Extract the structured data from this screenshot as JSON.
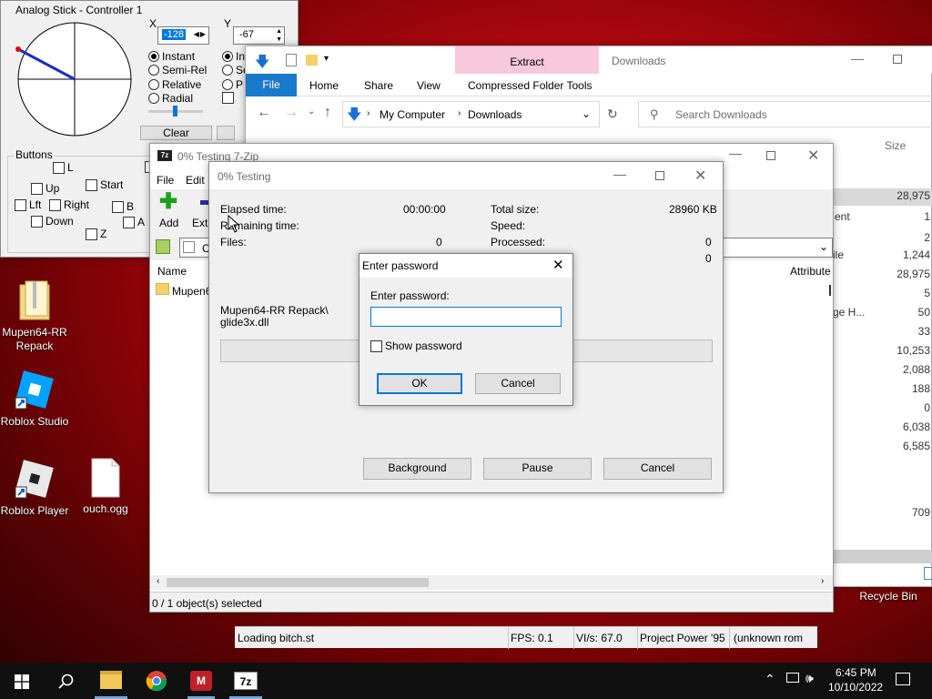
{
  "analog": {
    "title": "Analog Stick - Controller 1",
    "x_label": "X",
    "x_value": "-128",
    "y_label": "Y",
    "y_value": "-67",
    "modes": [
      "Instant",
      "Semi-Rel",
      "Relative",
      "Radial"
    ],
    "modes2": [
      "Ins",
      "Se",
      "P"
    ],
    "clear": "Clear",
    "buttons_label": "Buttons",
    "btns": {
      "l": "L",
      "start": "Start",
      "up": "Up",
      "lft": "Lft",
      "right": "Right",
      "b": "B",
      "down": "Down",
      "a": "A",
      "z": "Z"
    }
  },
  "explorer": {
    "title": "Downloads",
    "ribbon_tabs": {
      "file": "File",
      "home": "Home",
      "share": "Share",
      "view": "View",
      "extract": "Extract",
      "cft": "Compressed Folder Tools"
    },
    "crumb": {
      "root": "My Computer",
      "current": "Downloads"
    },
    "search_placeholder": "Search Downloads",
    "size_header": "Size",
    "partial_col": [
      "ent",
      "ile",
      "ge H..."
    ],
    "sizes": [
      "28,975",
      "1",
      "2",
      "1,244",
      "28,975",
      "5",
      "50",
      "33",
      "10,253",
      "2,088",
      "188",
      "0",
      "6,038",
      "6,585",
      "709"
    ]
  },
  "sevenzip": {
    "title": "0% Testing 7-Zip",
    "menu": {
      "file": "File",
      "edit": "Edit"
    },
    "toolbar": {
      "add": "Add",
      "extract": "Extr"
    },
    "path_prefix": "C",
    "col_name": "Name",
    "col_attr": "Attribute",
    "row": "Mupen6",
    "status": "0 / 1 object(s) selected"
  },
  "testing": {
    "title": "0% Testing",
    "elapsed_label": "Elapsed time:",
    "elapsed_value": "00:00:00",
    "remaining_label": "Remaining time:",
    "files_label": "Files:",
    "files_value": "0",
    "total_label": "Total size:",
    "total_value": "28960 KB",
    "speed_label": "Speed:",
    "processed_label": "Processed:",
    "processed_value": "0",
    "extra_value": "0",
    "path1": "Mupen64-RR Repack\\",
    "path2": "glide3x.dll",
    "background": "Background",
    "pause": "Pause",
    "cancel": "Cancel"
  },
  "password": {
    "title": "Enter password",
    "label": "Enter password:",
    "value": "",
    "show": "Show password",
    "ok": "OK",
    "cancel": "Cancel"
  },
  "mupen_status": {
    "text": "Loading bitch.st",
    "fps": "FPS: 0.1",
    "vis": "VI/s: 67.0",
    "game": "Project Power '95",
    "rom": "(unknown rom"
  },
  "desktop": {
    "mupen": "Mupen64-RR Repack",
    "roblox_studio": "Roblox Studio",
    "roblox_player": "Roblox Player",
    "ouch": "ouch.ogg",
    "recycle": "Recycle Bin"
  },
  "taskbar": {
    "time": "6:45 PM",
    "date": "10/10/2022"
  },
  "colors": {
    "accent": "#0078d7",
    "extract_tab": "#f8c8dc",
    "desktop_red": "#b00810"
  }
}
